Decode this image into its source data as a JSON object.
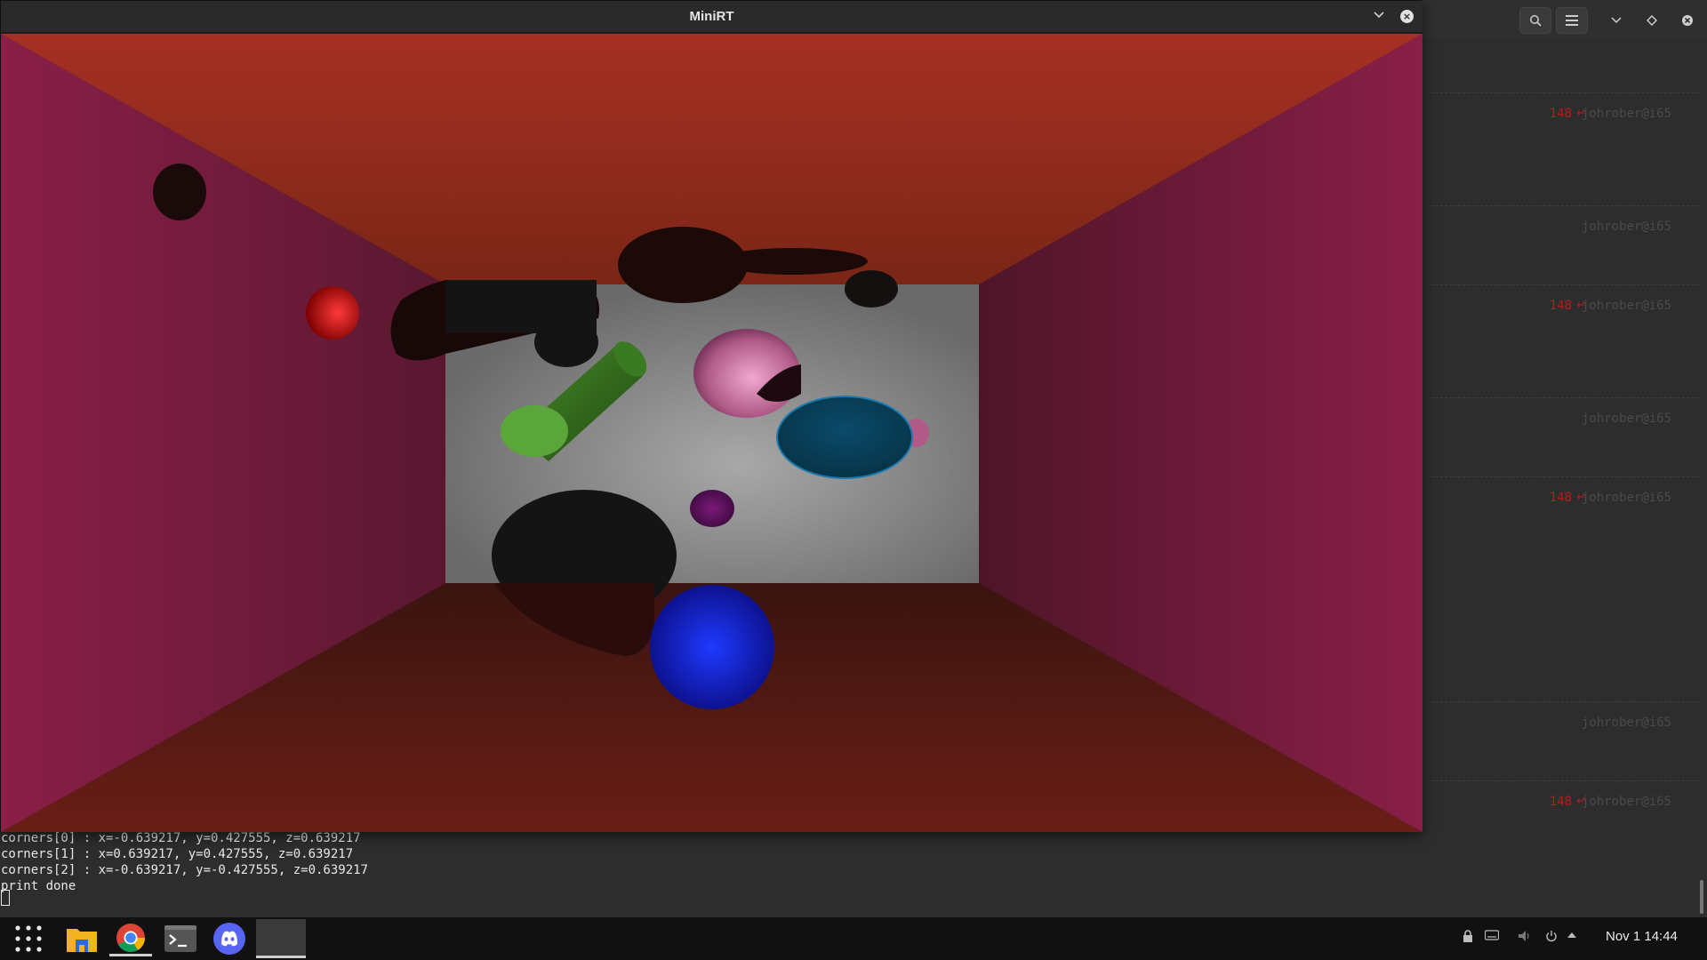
{
  "window": {
    "title": "MiniRT"
  },
  "terminal": {
    "prompts": [
      {
        "code": "148",
        "user": "johrober@i65"
      },
      {
        "code": "",
        "user": "johrober@i65"
      },
      {
        "code": "148",
        "user": "johrober@i65"
      },
      {
        "code": "",
        "user": "johrober@i65"
      },
      {
        "code": "148",
        "user": "johrober@i65"
      },
      {
        "code": "",
        "user": "johrober@i65"
      },
      {
        "code": "148",
        "user": "johrober@i65"
      }
    ],
    "output": [
      "corners[0] : x=-0.639217, y=0.427555, z=0.639217",
      "corners[1] : x=0.639217, y=0.427555, z=0.639217",
      "corners[2] : x=-0.639217, y=-0.427555, z=0.639217",
      "print done"
    ]
  },
  "taskbar": {
    "apps": [
      "apps-grid",
      "files",
      "chrome",
      "terminal",
      "discord"
    ],
    "clock": "Nov 1  14:44"
  },
  "icons": {
    "search": "search-icon",
    "menu": "hamburger-menu-icon",
    "chevron": "chevron-down-icon",
    "diamond": "diamond-icon",
    "close": "close-icon"
  }
}
